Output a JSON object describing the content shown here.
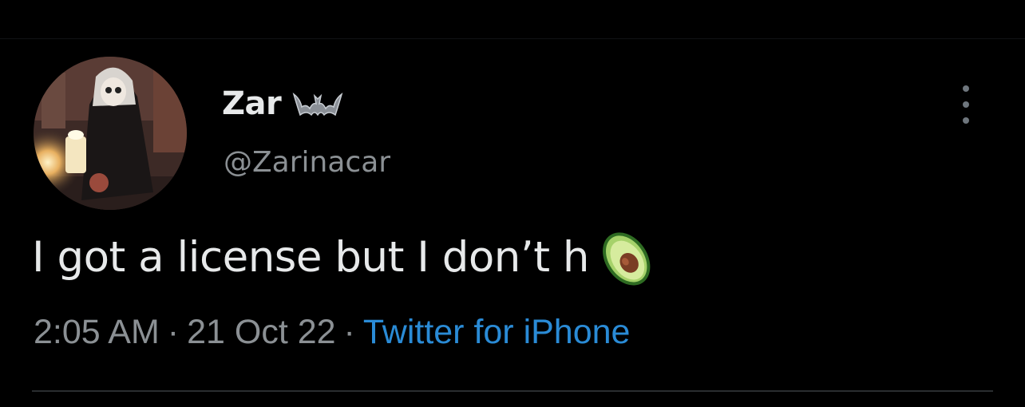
{
  "tweet": {
    "display_name": "Zar",
    "name_badge_icon": "bat-icon",
    "handle": "@Zarinacar",
    "text": "I got a license but I don’t h",
    "text_emoji_icon": "avocado-icon",
    "time": "2:05 AM",
    "separator": "·",
    "date": "21 Oct 22",
    "source": "Twitter for iPhone",
    "more_icon": "more-options-icon"
  },
  "colors": {
    "background": "#000000",
    "primary_text": "#e7e9ea",
    "secondary_text": "#8b9094",
    "link": "#2a8bd6"
  }
}
